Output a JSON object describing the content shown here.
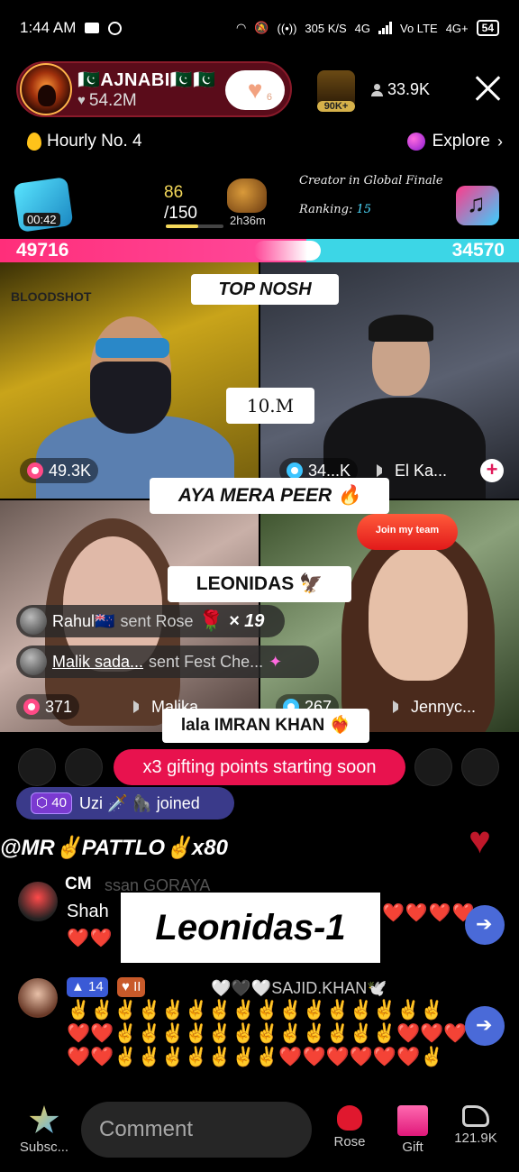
{
  "status_bar": {
    "time": "1:44 AM",
    "net_speed": "305 K/S",
    "network_1": "4G",
    "network_2": "Vo LTE",
    "network_3": "4G+",
    "battery": "54"
  },
  "host": {
    "name": "🇵🇰AJNABI🇵🇰🇵🇰",
    "likes": "54.2M",
    "follow_badge": "6"
  },
  "top_right": {
    "gift_rank_badge": "90K+",
    "viewers": "33.9K"
  },
  "hourly": {
    "label": "Hourly No. 4"
  },
  "explore": {
    "label": "Explore"
  },
  "battle": {
    "timer": "00:42",
    "score_current": "86",
    "score_total": "/150",
    "score_progress": 0.57,
    "lion_time": "2h36m",
    "creator_text": "Creator in Global Finale",
    "ranking_label": "Ranking:",
    "ranking_value": "15",
    "left_score": "49716",
    "right_score": "34570",
    "left_share": 0.59
  },
  "tiles": {
    "t1_brand": "BLOODSHOT",
    "t1_count": "49.3K",
    "t2_count": "34...K",
    "t2_name": "El Ka...",
    "t3_count": "371",
    "t3_name": "Malika",
    "t4_count": "267",
    "t4_name": "Jennyc...",
    "join_team": "Join my team"
  },
  "overlays": {
    "top": "TOP NOSH",
    "ten_m": "10.M",
    "aya": "AYA MERA PEER 🔥",
    "leonidas": "LEONIDAS 🦅",
    "lala": "lala IMRAN KHAN ❤️‍🔥",
    "big": "Leonidas-1"
  },
  "gifts": [
    {
      "name": "Rahul🇳🇿",
      "sent": "sent Rose",
      "count": "× 19"
    },
    {
      "name": "Malik sada...",
      "sent": "sent Fest Che..."
    }
  ],
  "gifting_banner": "x3 gifting points starting soon",
  "joined": {
    "level": "40",
    "text": "Uzi 🗡️ 🦍 joined"
  },
  "vip_line": "@MR✌️PATTLO✌️x80",
  "chat": [
    {
      "name": "CM",
      "ghost": "ssan GORAYA",
      "text": "Shah",
      "hearts_right": "❤️❤️❤️❤️",
      "hearts_left": "❤️❤️"
    },
    {
      "level": "14",
      "fan": "II",
      "name": "🤍🖤🤍SAJID.KHAN🕊️",
      "emoji_line1": "✌️✌️✌️✌️✌️✌️✌️✌️✌️✌️✌️✌️✌️✌️✌️✌️",
      "emoji_line2": "❤️❤️✌️✌️✌️✌️✌️✌️✌️✌️✌️✌️✌️✌️❤️❤️❤️",
      "emoji_line3": "❤️❤️✌️✌️✌️✌️✌️✌️✌️❤️❤️❤️❤️❤️❤️✌️"
    }
  ],
  "bottom_bar": {
    "subscribe": "Subsc...",
    "comment_placeholder": "Comment",
    "rose": "Rose",
    "gift": "Gift",
    "share_count": "121.9K"
  },
  "colors": {
    "battle_pink": "#ff2e7a",
    "battle_cyan": "#3cd6e6",
    "gifting_red": "#e8124e",
    "score_yellow": "#f4d85a"
  }
}
